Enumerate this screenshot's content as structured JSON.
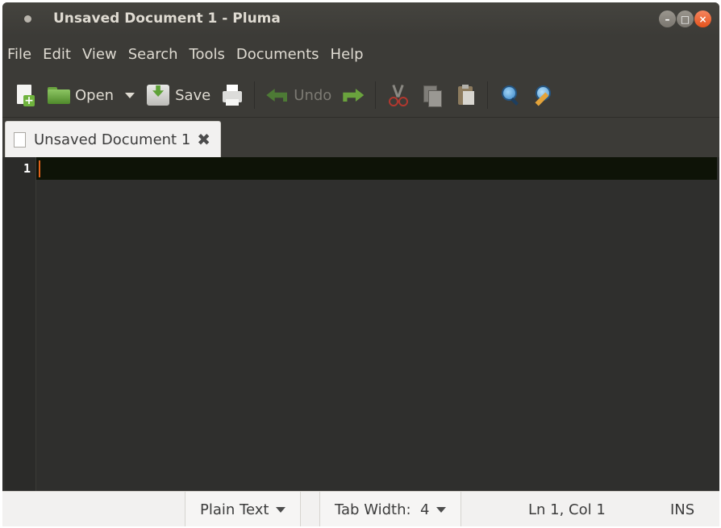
{
  "window": {
    "title": "Unsaved Document 1 - Pluma"
  },
  "menubar": {
    "items": [
      "File",
      "Edit",
      "View",
      "Search",
      "Tools",
      "Documents",
      "Help"
    ]
  },
  "toolbar": {
    "new_icon": "new-document-icon",
    "open_label": "Open",
    "save_label": "Save",
    "undo_label": "Undo"
  },
  "tabs": [
    {
      "label": "Unsaved Document 1",
      "close_icon": "close-icon"
    }
  ],
  "editor": {
    "line_numbers": [
      "1"
    ],
    "content": ""
  },
  "statusbar": {
    "language": "Plain Text",
    "tab_width": "Tab Width:  4",
    "position": "Ln 1, Col 1",
    "mode": "INS"
  },
  "colors": {
    "window_bg": "#3c3b37",
    "editor_bg": "#2f2f2d",
    "current_line": "#0e1307",
    "cursor": "#e0621b",
    "close_button": "#e4531c"
  }
}
